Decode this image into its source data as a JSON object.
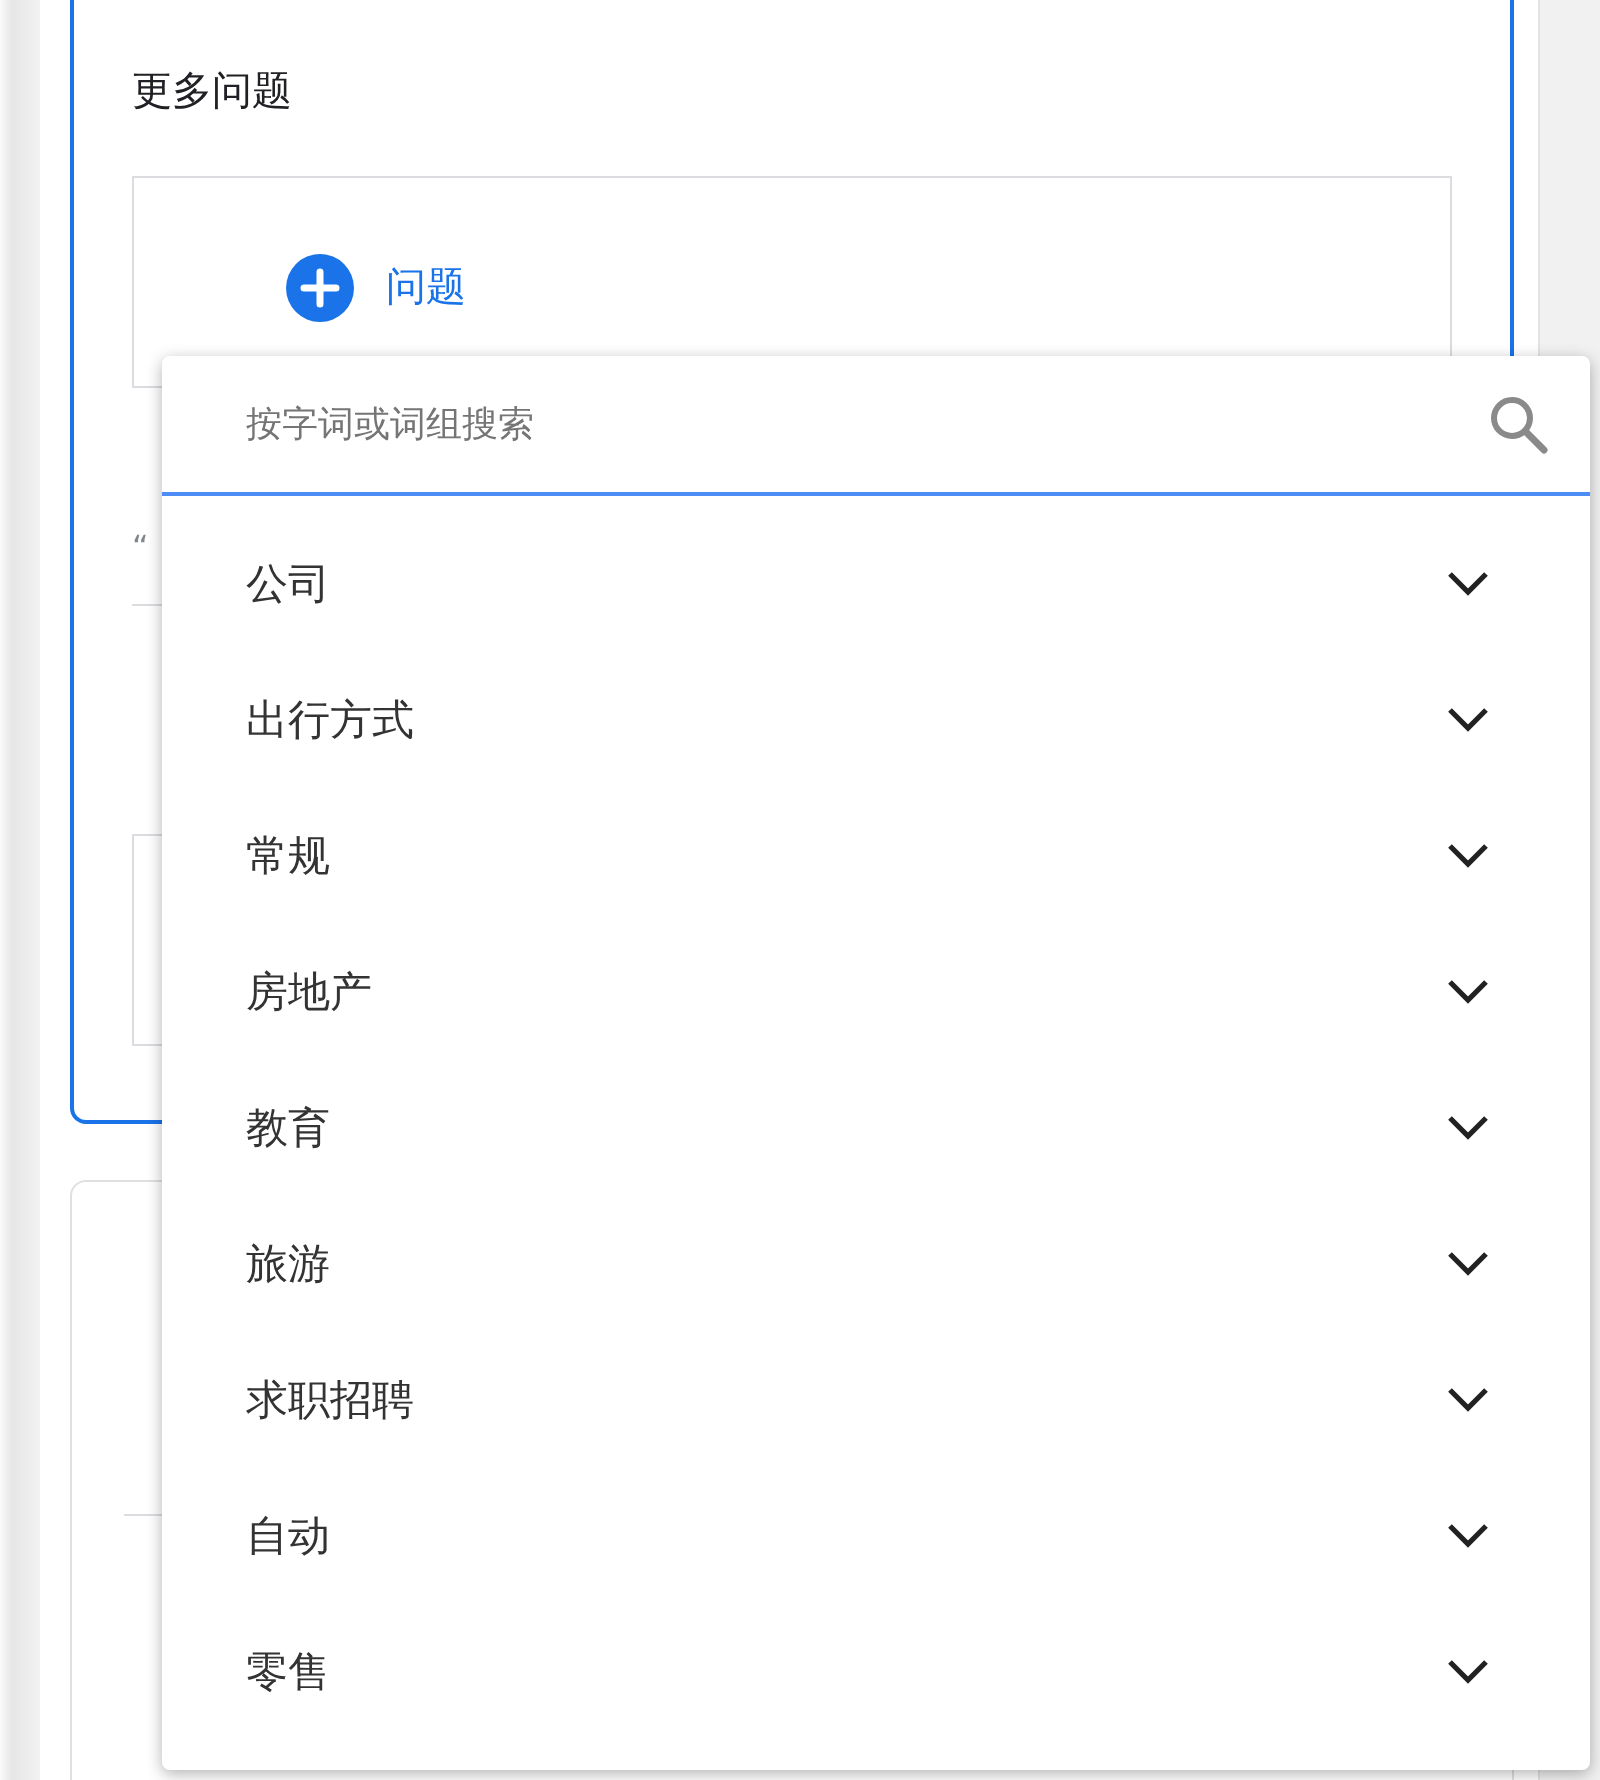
{
  "section": {
    "title": "更多问题",
    "add_button": {
      "label": "问题"
    },
    "field_hint": "“"
  },
  "dropdown": {
    "search": {
      "placeholder": "按字词或词组搜索"
    },
    "categories": [
      {
        "label": "公司",
        "expanded": false
      },
      {
        "label": "出行方式",
        "expanded": false
      },
      {
        "label": "常规",
        "expanded": false
      },
      {
        "label": "房地产",
        "expanded": false
      },
      {
        "label": "教育",
        "expanded": false
      },
      {
        "label": "旅游",
        "expanded": false
      },
      {
        "label": "求职招聘",
        "expanded": false
      },
      {
        "label": "自动",
        "expanded": false
      },
      {
        "label": "零售",
        "expanded": false
      }
    ]
  }
}
